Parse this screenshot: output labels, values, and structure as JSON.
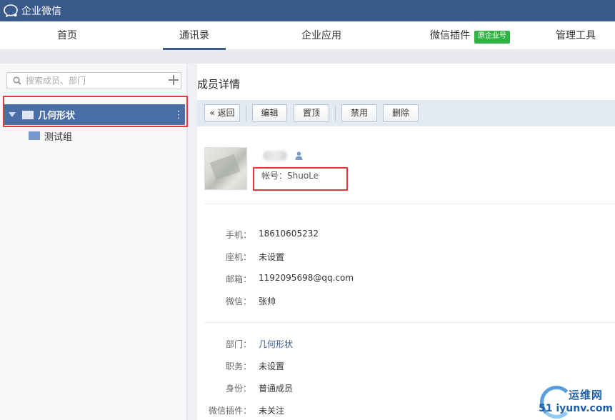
{
  "app": {
    "title": "企业微信"
  },
  "nav": {
    "items": [
      {
        "label": "首页"
      },
      {
        "label": "通讯录",
        "active": true
      },
      {
        "label": "企业应用"
      },
      {
        "label": "微信插件",
        "badge": "原企业号"
      },
      {
        "label": "管理工具"
      }
    ]
  },
  "sidebar": {
    "search_placeholder": "搜索成员、部门",
    "root": {
      "label": "几何形状"
    },
    "children": [
      {
        "label": "测试组"
      }
    ]
  },
  "detail": {
    "title": "成员详情",
    "toolbar": {
      "back": "返回",
      "edit": "编辑",
      "pin": "置顶",
      "disable": "禁用",
      "delete": "删除"
    },
    "account": "帐号：ShuoLe",
    "contact": [
      {
        "label": "手机：",
        "value": "18610605232"
      },
      {
        "label": "座机：",
        "value": "未设置"
      },
      {
        "label": "邮箱：",
        "value": "1192095698@qq.com"
      },
      {
        "label": "微信：",
        "value": "张帅"
      }
    ],
    "org": [
      {
        "label": "部门：",
        "value": "几何形状",
        "link": true
      },
      {
        "label": "职务：",
        "value": "未设置"
      },
      {
        "label": "身份：",
        "value": "普通成员"
      },
      {
        "label": "微信插件：",
        "value": "未关注"
      }
    ]
  },
  "watermark": {
    "line1": "运维网",
    "line2": "51 iyunv.com"
  },
  "colors": {
    "header": "#3a5a8c",
    "selected": "#4a6ea6",
    "badge": "#2fb343",
    "highlight": "#e4393c"
  }
}
